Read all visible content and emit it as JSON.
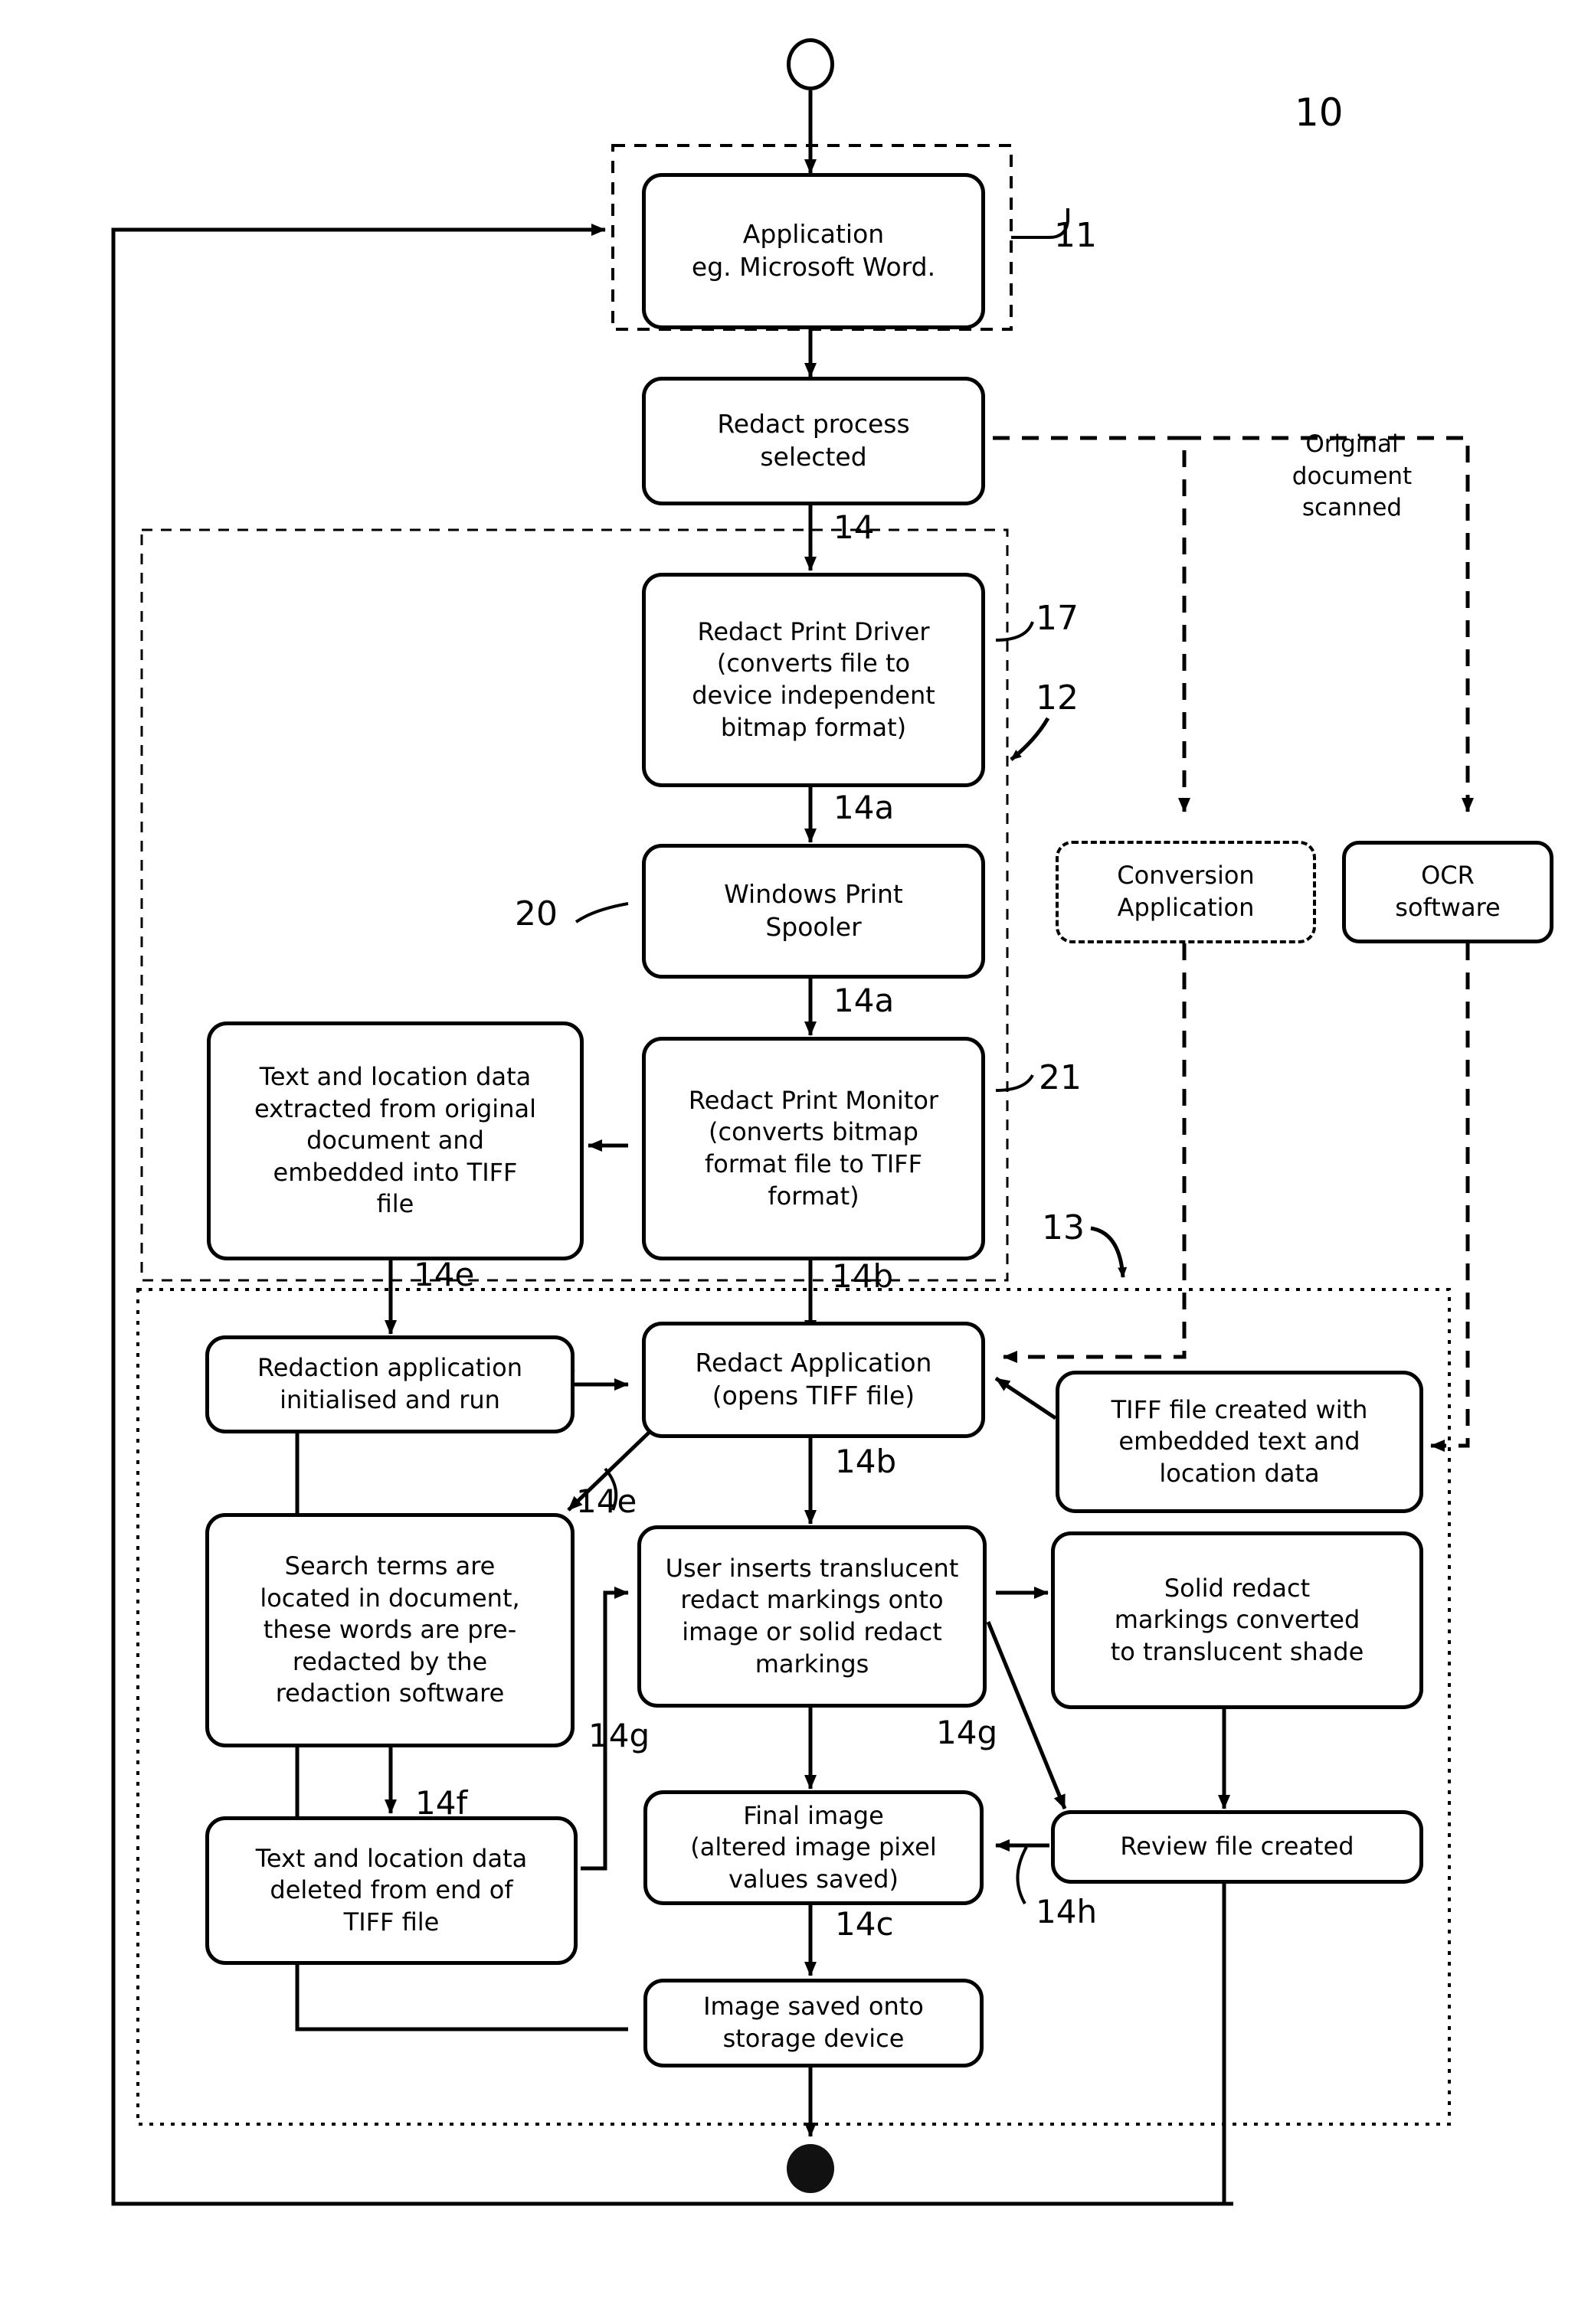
{
  "figure": {
    "ref_main": "10",
    "reference_numbers": [
      {
        "id": "ref-10",
        "label": "10"
      },
      {
        "id": "ref-11",
        "label": "11"
      },
      {
        "id": "ref-12",
        "label": "12"
      },
      {
        "id": "ref-13",
        "label": "13"
      },
      {
        "id": "ref-17",
        "label": "17"
      },
      {
        "id": "ref-20",
        "label": "20"
      },
      {
        "id": "ref-21",
        "label": "21"
      }
    ],
    "step_labels": [
      {
        "id": "step-14",
        "label": "14"
      },
      {
        "id": "step-14a-1",
        "label": "14a"
      },
      {
        "id": "step-14a-2",
        "label": "14a"
      },
      {
        "id": "step-14b-1",
        "label": "14b"
      },
      {
        "id": "step-14b-2",
        "label": "14b"
      },
      {
        "id": "step-14c",
        "label": "14c"
      },
      {
        "id": "step-14e-1",
        "label": "14e"
      },
      {
        "id": "step-14e-2",
        "label": "14e"
      },
      {
        "id": "step-14f",
        "label": "14f"
      },
      {
        "id": "step-14g-1",
        "label": "14g"
      },
      {
        "id": "step-14g-2",
        "label": "14g"
      },
      {
        "id": "step-14h",
        "label": "14h"
      }
    ]
  },
  "annotations": {
    "original_document_scanned": "Original\ndocument\nscanned"
  },
  "nodes": {
    "application": "Application\neg. Microsoft Word.",
    "redact_process_selected": "Redact process\nselected",
    "redact_print_driver": "Redact Print Driver\n(converts file to\ndevice independent\nbitmap format)",
    "windows_print_spooler": "Windows Print\nSpooler",
    "redact_print_monitor": "Redact Print Monitor\n(converts bitmap\nformat file to TIFF\nformat)",
    "text_location_extracted": "Text and location data\nextracted from original\ndocument and\nembedded into TIFF\nfile",
    "conversion_application": "Conversion\nApplication",
    "ocr_software": "OCR\nsoftware",
    "redaction_app_init": "Redaction application\ninitialised and run",
    "redact_application": "Redact Application\n(opens TIFF file)",
    "tiff_file_created": "TIFF file created with\nembedded text and\nlocation data",
    "search_terms": "Search terms are\nlocated in document,\nthese words are pre-\nredacted by the\nredaction software",
    "user_inserts_markings": "User inserts translucent\nredact markings onto\nimage or solid redact\nmarkings",
    "solid_to_translucent": "Solid redact\nmarkings converted\nto translucent shade",
    "text_location_deleted": "Text and location data\ndeleted from end of\nTIFF file",
    "final_image": "Final image\n(altered image pixel\nvalues saved)",
    "review_file_created": "Review file created",
    "image_saved": "Image saved onto\nstorage device"
  },
  "colors": {
    "stroke": "#000000",
    "background": "#ffffff",
    "end_node_fill": "#111111"
  }
}
